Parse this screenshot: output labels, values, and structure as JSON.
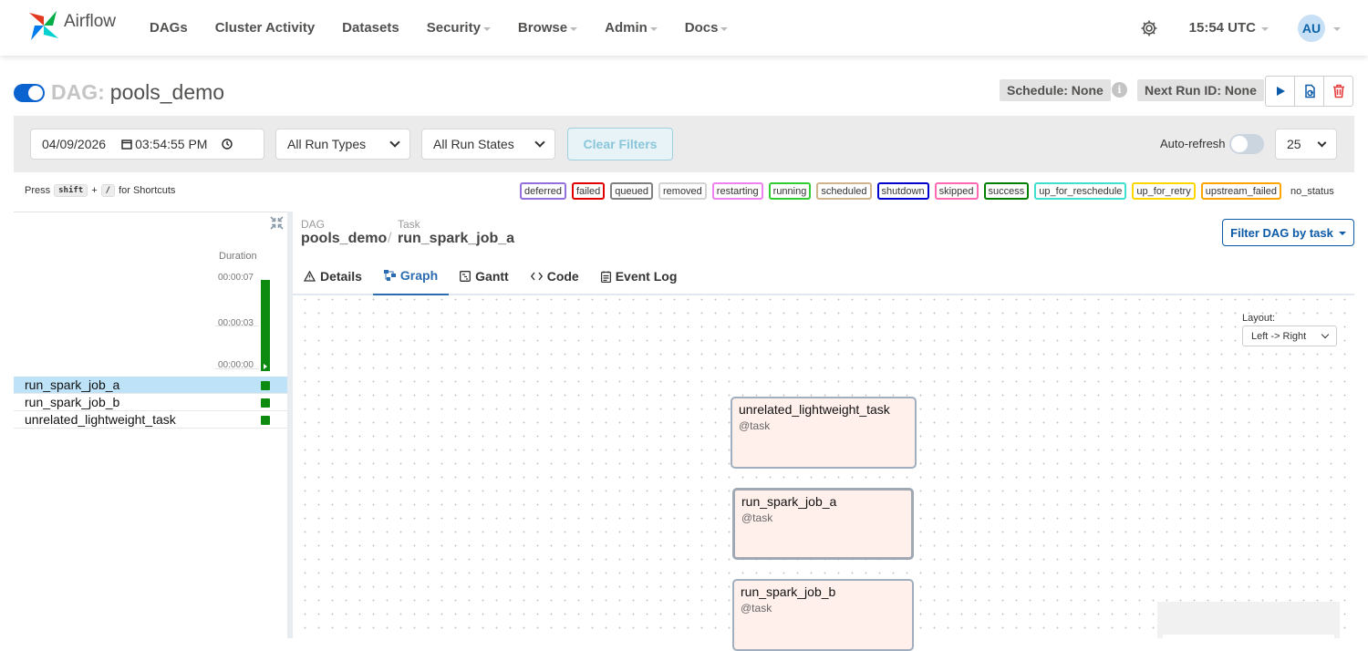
{
  "navbar": {
    "brand": "Airflow",
    "items": [
      {
        "label": "DAGs",
        "dropdown": false
      },
      {
        "label": "Cluster Activity",
        "dropdown": false
      },
      {
        "label": "Datasets",
        "dropdown": false
      },
      {
        "label": "Security",
        "dropdown": true
      },
      {
        "label": "Browse",
        "dropdown": true
      },
      {
        "label": "Admin",
        "dropdown": true
      },
      {
        "label": "Docs",
        "dropdown": true
      }
    ],
    "time": "15:54 UTC",
    "avatar": "AU"
  },
  "dag": {
    "prefix": "DAG:",
    "name": "pools_demo",
    "paused": false,
    "schedule": "Schedule: None",
    "next_run": "Next Run ID: None"
  },
  "filters": {
    "date": "04/09/2026",
    "time": "03:54:55 PM",
    "run_types": "All Run Types",
    "run_states": "All Run States",
    "clear": "Clear Filters",
    "auto_refresh": "Auto-refresh",
    "page_size": "25"
  },
  "shortcuts": {
    "press": "Press",
    "key1": "shift",
    "plus": "+",
    "key2": "/",
    "suffix": "for Shortcuts"
  },
  "legend": [
    {
      "label": "deferred",
      "color": "#9370db"
    },
    {
      "label": "failed",
      "color": "#e00000"
    },
    {
      "label": "queued",
      "color": "#808080"
    },
    {
      "label": "removed",
      "color": "#d3d3d3"
    },
    {
      "label": "restarting",
      "color": "#ee82ee"
    },
    {
      "label": "running",
      "color": "#32cd32"
    },
    {
      "label": "scheduled",
      "color": "#d2b48c"
    },
    {
      "label": "shutdown",
      "color": "#0000cc"
    },
    {
      "label": "skipped",
      "color": "#ff69b4"
    },
    {
      "label": "success",
      "color": "#008000"
    },
    {
      "label": "up_for_reschedule",
      "color": "#40e0d0"
    },
    {
      "label": "up_for_retry",
      "color": "#ffd700"
    },
    {
      "label": "upstream_failed",
      "color": "#ffa500"
    },
    {
      "label": "no_status",
      "color": ""
    }
  ],
  "grid": {
    "duration_label": "Duration",
    "ticks": [
      "00:00:07",
      "00:00:03",
      "00:00:00"
    ],
    "tasks": [
      "run_spark_job_a",
      "run_spark_job_b",
      "unrelated_lightweight_task"
    ],
    "selected_task": "run_spark_job_a",
    "task_state": "success"
  },
  "details": {
    "crumb_dag_label": "DAG",
    "crumb_dag": "pools_demo",
    "crumb_task_label": "Task",
    "crumb_task": "run_spark_job_a",
    "filter_btn": "Filter DAG by task",
    "tabs": [
      "Details",
      "Graph",
      "Gantt",
      "Code",
      "Event Log"
    ],
    "active_tab": "Graph"
  },
  "graph": {
    "layout_label": "Layout:",
    "layout_value": "Left -> Right",
    "nodes": [
      {
        "name": "unrelated_lightweight_task",
        "type": "@task"
      },
      {
        "name": "run_spark_job_a",
        "type": "@task"
      },
      {
        "name": "run_spark_job_b",
        "type": "@task"
      }
    ]
  },
  "colors": {
    "accent": "#0b5aa7",
    "success": "#0d8a10",
    "node_fill": "#fff0eb"
  }
}
